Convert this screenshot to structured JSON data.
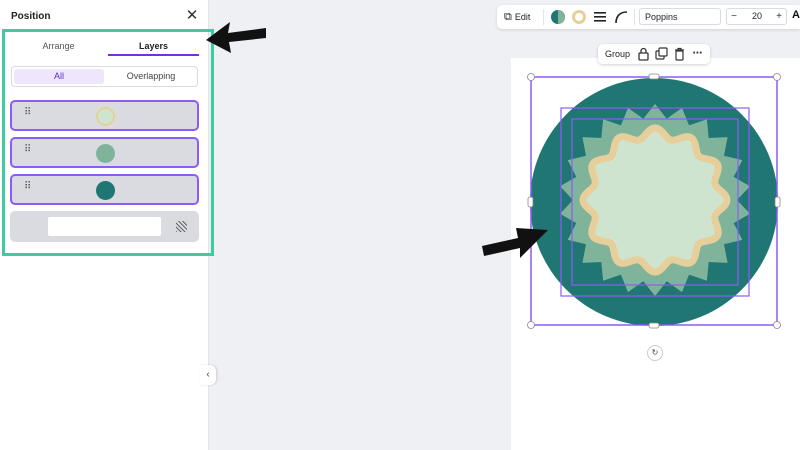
{
  "panel": {
    "title": "Position",
    "tabs": [
      {
        "label": "Arrange",
        "active": false
      },
      {
        "label": "Layers",
        "active": true
      }
    ],
    "filters": [
      {
        "label": "All",
        "active": true
      },
      {
        "label": "Overlapping",
        "active": false
      }
    ],
    "layers": [
      {
        "name": "light-circle",
        "color": "#cfe4cf",
        "ring": "#e6cf9a"
      },
      {
        "name": "sage-circle",
        "color": "#7fb49b"
      },
      {
        "name": "teal-circle",
        "color": "#1f7672"
      }
    ],
    "background_swatch": "#ffffff"
  },
  "toolbar": {
    "edit_label": "Edit",
    "font": "Poppins",
    "font_size": "20",
    "minus": "−",
    "plus": "+",
    "text_color_glyph": "A"
  },
  "group_bar": {
    "label": "Group"
  },
  "colors": {
    "accent": "#7d2ae8",
    "highlight": "#3ecaa3",
    "teal": "#1f7672",
    "sage": "#7fb49b",
    "light_green": "#cfe4cf",
    "tan": "#e6cf9a",
    "selection": "#8b5cf6"
  }
}
